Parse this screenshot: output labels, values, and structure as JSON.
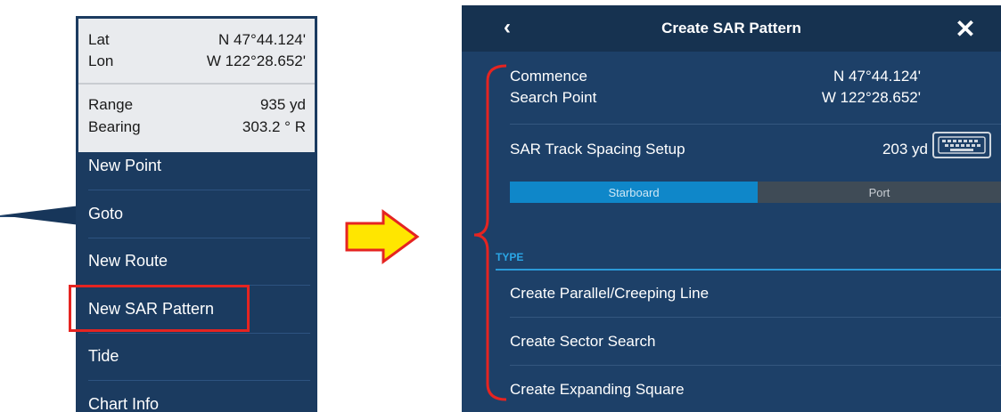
{
  "context_menu": {
    "info": {
      "lat_label": "Lat",
      "lat_value": "N 47°44.124'",
      "lon_label": "Lon",
      "lon_value": "W 122°28.652'",
      "range_label": "Range",
      "range_value": "935 yd",
      "bearing_label": "Bearing",
      "bearing_value": "303.2 ° R"
    },
    "items": [
      {
        "label": "New Point"
      },
      {
        "label": "Goto"
      },
      {
        "label": "New Route"
      },
      {
        "label": "New SAR Pattern"
      },
      {
        "label": "Tide"
      },
      {
        "label": "Chart Info"
      }
    ],
    "highlighted_item": "New SAR Pattern"
  },
  "dialog": {
    "title": "Create SAR Pattern",
    "back_icon": "chevron-left-icon",
    "close_icon": "close-icon",
    "commence": {
      "label_line1": "Commence",
      "label_line2": "Search Point",
      "lat": "N 47°44.124'",
      "lon": "W 122°28.652'"
    },
    "track_spacing": {
      "label": "SAR Track Spacing Setup",
      "value": "203 yd",
      "icon": "keyboard-icon"
    },
    "side_toggle": {
      "options": [
        "Starboard",
        "Port"
      ],
      "selected": "Starboard"
    },
    "type_section": {
      "heading": "TYPE",
      "actions": [
        {
          "label": "Create Parallel/Creeping Line"
        },
        {
          "label": "Create Sector Search"
        },
        {
          "label": "Create Expanding Square"
        }
      ]
    }
  },
  "colors": {
    "panel_bg": "#1b3b60",
    "accent_blue": "#0f87c9",
    "highlight_red": "#e52421",
    "arrow_yellow": "#ffe600"
  }
}
